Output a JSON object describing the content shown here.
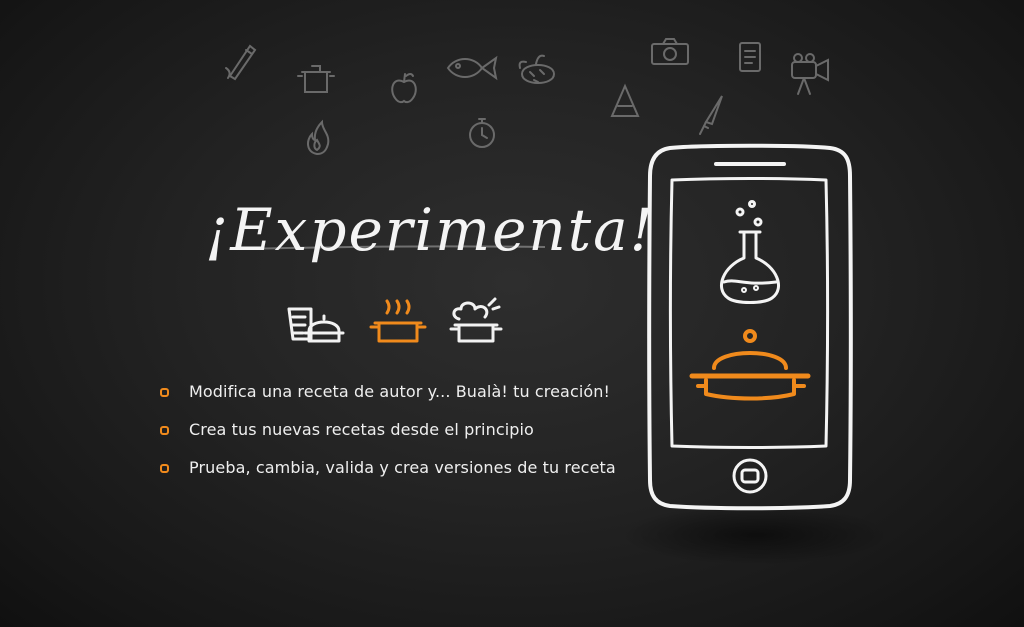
{
  "headline": "¡Experimenta!",
  "colors": {
    "accent": "#f08a1c",
    "chalk": "#f2f2f2",
    "board": "#262626"
  },
  "doodle_icons": [
    "pencil-icon",
    "pot-icon",
    "apple-icon",
    "fire-icon",
    "fish-icon",
    "pudding-icon",
    "stopwatch-icon",
    "camera-icon",
    "funnel-icon",
    "notepad-icon",
    "knife-icon",
    "video-camera-icon"
  ],
  "feature_icons": [
    "recipe-book-icon",
    "cooking-pot-icon",
    "chef-pot-icon"
  ],
  "bullets": [
    "Modifica una receta de autor y... Bualà! tu creación!",
    "Crea tus nuevas recetas desde el principio",
    "Prueba, cambia, valida y crea versiones de tu receta"
  ],
  "phone": {
    "screen_icons": [
      "flask-icon",
      "serving-dish-icon"
    ]
  }
}
